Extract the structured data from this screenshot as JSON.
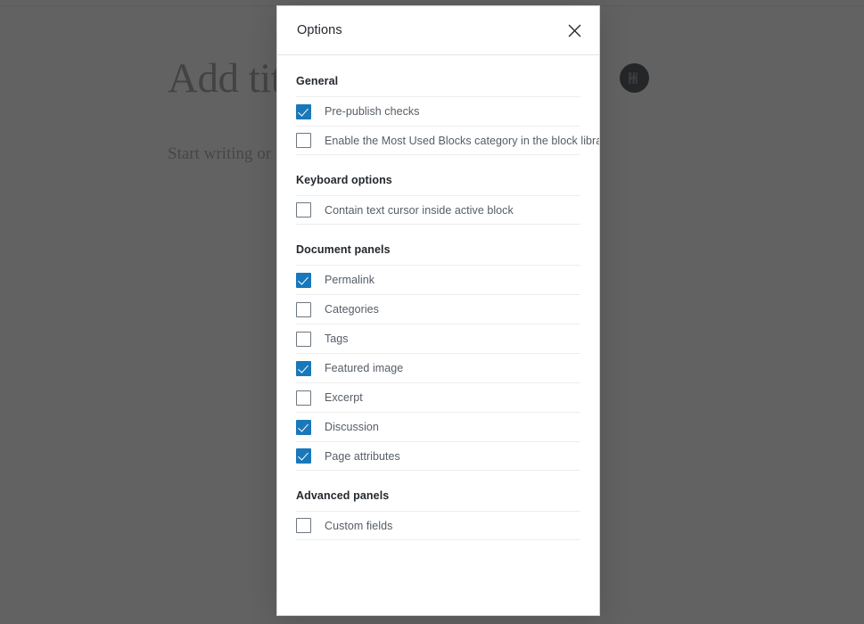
{
  "editor": {
    "title_placeholder": "Add title",
    "body_placeholder": "Start writing or type / to choose a block",
    "logo_icon": "wordpress-logo-icon",
    "colors": {
      "overlay": "#4b4b4b",
      "logo_background": "#23282d"
    }
  },
  "modal": {
    "title": "Options",
    "close_icon": "close-icon",
    "close_label": "Close dialog",
    "accent_color": "#1878b9",
    "sections": [
      {
        "title": "General",
        "options": [
          {
            "label": "Pre-publish checks",
            "checked": true
          },
          {
            "label": "Enable the Most Used Blocks category in the block library",
            "checked": false
          }
        ]
      },
      {
        "title": "Keyboard options",
        "options": [
          {
            "label": "Contain text cursor inside active block",
            "checked": false
          }
        ]
      },
      {
        "title": "Document panels",
        "options": [
          {
            "label": "Permalink",
            "checked": true
          },
          {
            "label": "Categories",
            "checked": false
          },
          {
            "label": "Tags",
            "checked": false
          },
          {
            "label": "Featured image",
            "checked": true
          },
          {
            "label": "Excerpt",
            "checked": false
          },
          {
            "label": "Discussion",
            "checked": true
          },
          {
            "label": "Page attributes",
            "checked": true
          }
        ]
      },
      {
        "title": "Advanced panels",
        "options": [
          {
            "label": "Custom fields",
            "checked": false
          }
        ]
      }
    ]
  }
}
